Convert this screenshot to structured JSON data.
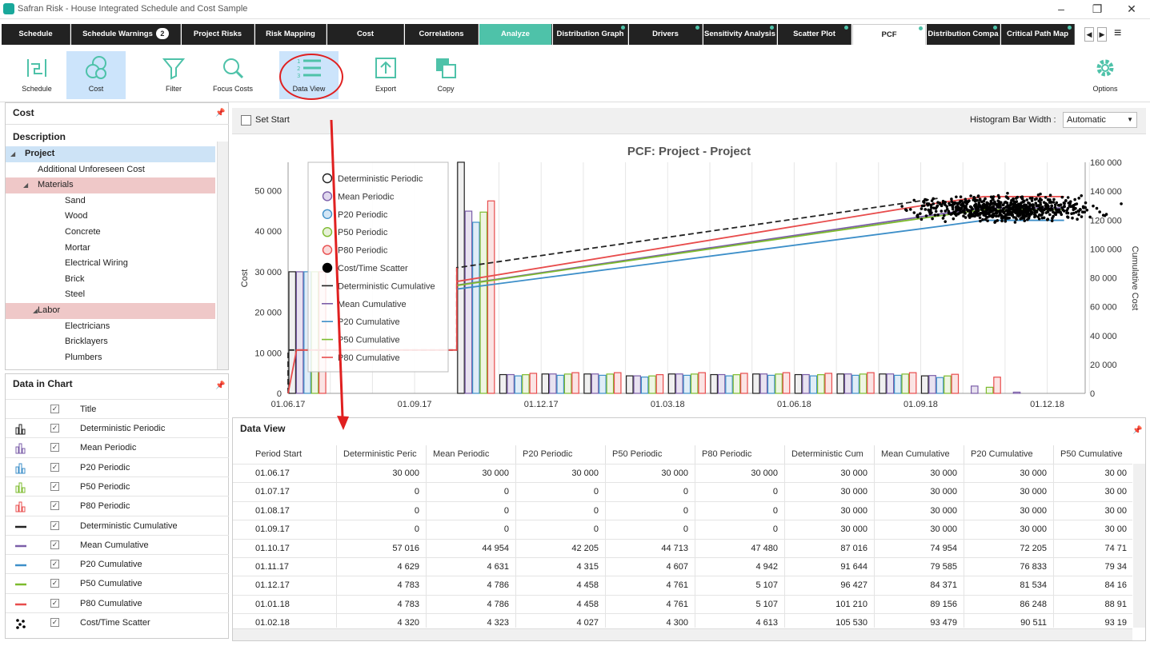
{
  "window": {
    "title": "Safran Risk - House Integrated Schedule and Cost Sample"
  },
  "tabs": [
    {
      "label": "Schedule"
    },
    {
      "label": "Schedule Warnings",
      "badge": "2"
    },
    {
      "label": "Project Risks"
    },
    {
      "label": "Risk Mapping"
    },
    {
      "label": "Cost"
    },
    {
      "label": "Correlations"
    },
    {
      "label": "Analyze"
    },
    {
      "label": "Distribution Graph"
    },
    {
      "label": "Drivers"
    },
    {
      "label": "Sensitivity Analysis"
    },
    {
      "label": "Scatter Plot"
    },
    {
      "label": "PCF"
    },
    {
      "label": "Distribution Compa"
    },
    {
      "label": "Critical Path Map"
    }
  ],
  "toolbar": {
    "schedule": "Schedule",
    "cost": "Cost",
    "filter": "Filter",
    "focus_costs": "Focus Costs",
    "data_view": "Data View",
    "export": "Export",
    "copy": "Copy",
    "options": "Options"
  },
  "cost_panel": {
    "title": "Cost",
    "description_header": "Description",
    "tree": [
      "Project",
      "Additional Unforeseen Cost",
      "Materials",
      "Sand",
      "Wood",
      "Concrete",
      "Mortar",
      "Electrical Wiring",
      "Brick",
      "Steel",
      "Labor",
      "Electricians",
      "Bricklayers",
      "Plumbers"
    ]
  },
  "data_in_chart": {
    "title": "Data in Chart",
    "title_col": "Title",
    "items": [
      "Deterministic Periodic",
      "Mean Periodic",
      "P20 Periodic",
      "P50 Periodic",
      "P80 Periodic",
      "Deterministic Cumulative",
      "Mean Cumulative",
      "P20 Cumulative",
      "P50 Cumulative",
      "P80 Cumulative",
      "Cost/Time Scatter"
    ]
  },
  "chart_options": {
    "set_start": "Set Start",
    "bar_width_label": "Histogram Bar Width :",
    "bar_width_value": "Automatic"
  },
  "colors": {
    "deterministic": "#222222",
    "mean": "#7b5ea8",
    "p20": "#3d8fc9",
    "p50": "#7dbb2e",
    "p80": "#e84c4c",
    "accent": "#4ec2a9"
  },
  "chart_data": {
    "type": "bar",
    "title": "PCF: Project - Project",
    "ylabel": "Cost",
    "y2label": "Cumulative Cost",
    "ylim": [
      0,
      57000
    ],
    "y2lim": [
      0,
      160000
    ],
    "yticks": [
      "0",
      "10 000",
      "20 000",
      "30 000",
      "40 000",
      "50 000"
    ],
    "y2ticks": [
      "0",
      "20 000",
      "40 000",
      "60 000",
      "80 000",
      "100 000",
      "120 000",
      "140 000",
      "160 000"
    ],
    "xticks": [
      "01.06.17",
      "01.09.17",
      "01.12.17",
      "01.03.18",
      "01.06.18",
      "01.09.18",
      "01.12.18"
    ],
    "legend_position": "top-left",
    "legend": [
      "Deterministic Periodic",
      "Mean Periodic",
      "P20 Periodic",
      "P50 Periodic",
      "P80 Periodic",
      "Cost/Time Scatter",
      "Deterministic Cumulative",
      "Mean Cumulative",
      "P20 Cumulative",
      "P50 Cumulative",
      "P80 Cumulative"
    ],
    "categories": [
      "01.06.17",
      "01.07.17",
      "01.08.17",
      "01.09.17",
      "01.10.17",
      "01.11.17",
      "01.12.17",
      "01.01.18",
      "01.02.18",
      "01.03.18",
      "01.04.18",
      "01.05.18",
      "01.06.18",
      "01.07.18",
      "01.08.18",
      "01.09.18",
      "01.10.18",
      "01.11.18"
    ],
    "series": [
      {
        "name": "Deterministic Periodic",
        "values": [
          30000,
          0,
          0,
          0,
          57016,
          4629,
          4783,
          4783,
          4320,
          4783,
          4629,
          4783,
          4629,
          4783,
          4783,
          4320,
          0,
          0
        ]
      },
      {
        "name": "Mean Periodic",
        "values": [
          30000,
          0,
          0,
          0,
          44954,
          4631,
          4786,
          4786,
          4323,
          4786,
          4631,
          4786,
          4631,
          4786,
          4786,
          4400,
          1800,
          300
        ]
      },
      {
        "name": "P20 Periodic",
        "values": [
          30000,
          0,
          0,
          0,
          42205,
          4315,
          4458,
          4458,
          4027,
          4458,
          4315,
          4458,
          4315,
          4458,
          4458,
          3900,
          0,
          0
        ]
      },
      {
        "name": "P50 Periodic",
        "values": [
          30000,
          0,
          0,
          0,
          44713,
          4607,
          4761,
          4761,
          4300,
          4761,
          4607,
          4761,
          4607,
          4761,
          4761,
          4300,
          1500,
          0
        ]
      },
      {
        "name": "P80 Periodic",
        "values": [
          30000,
          0,
          0,
          0,
          47480,
          4942,
          5107,
          5107,
          4613,
          5107,
          4942,
          5107,
          4942,
          5107,
          5107,
          4700,
          4000,
          0
        ]
      }
    ]
  },
  "data_view": {
    "title": "Data View",
    "columns": [
      "Period Start",
      "Deterministic Peric",
      "Mean Periodic",
      "P20 Periodic",
      "P50 Periodic",
      "P80 Periodic",
      "Deterministic Cum",
      "Mean Cumulative",
      "P20 Cumulative",
      "P50 Cumulative"
    ],
    "rows": [
      [
        "01.06.17",
        "30 000",
        "30 000",
        "30 000",
        "30 000",
        "30 000",
        "30 000",
        "30 000",
        "30 000",
        "30 00"
      ],
      [
        "01.07.17",
        "0",
        "0",
        "0",
        "0",
        "0",
        "30 000",
        "30 000",
        "30 000",
        "30 00"
      ],
      [
        "01.08.17",
        "0",
        "0",
        "0",
        "0",
        "0",
        "30 000",
        "30 000",
        "30 000",
        "30 00"
      ],
      [
        "01.09.17",
        "0",
        "0",
        "0",
        "0",
        "0",
        "30 000",
        "30 000",
        "30 000",
        "30 00"
      ],
      [
        "01.10.17",
        "57 016",
        "44 954",
        "42 205",
        "44 713",
        "47 480",
        "87 016",
        "74 954",
        "72 205",
        "74 71"
      ],
      [
        "01.11.17",
        "4 629",
        "4 631",
        "4 315",
        "4 607",
        "4 942",
        "91 644",
        "79 585",
        "76 833",
        "79 34"
      ],
      [
        "01.12.17",
        "4 783",
        "4 786",
        "4 458",
        "4 761",
        "5 107",
        "96 427",
        "84 371",
        "81 534",
        "84 16"
      ],
      [
        "01.01.18",
        "4 783",
        "4 786",
        "4 458",
        "4 761",
        "5 107",
        "101 210",
        "89 156",
        "86 248",
        "88 91"
      ],
      [
        "01.02.18",
        "4 320",
        "4 323",
        "4 027",
        "4 300",
        "4 613",
        "105 530",
        "93 479",
        "90 511",
        "93 19"
      ]
    ]
  }
}
